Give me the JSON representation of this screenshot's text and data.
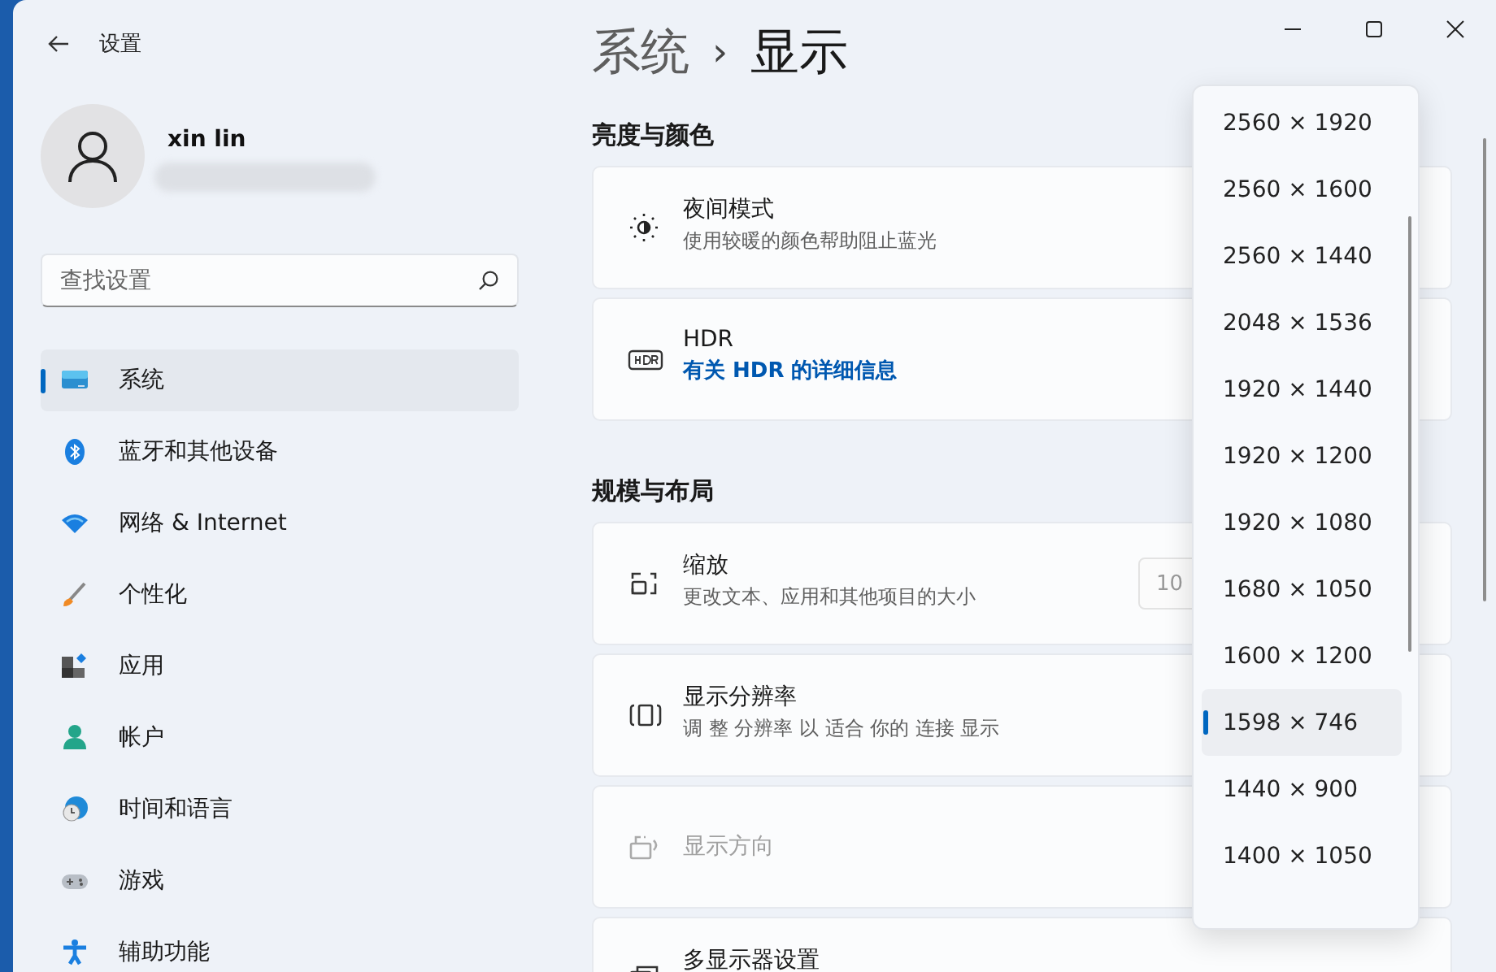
{
  "window": {
    "title": "设置"
  },
  "user": {
    "name": "xin lin"
  },
  "search": {
    "placeholder": "查找设置"
  },
  "sidebar": {
    "items": [
      {
        "label": "系统",
        "selected": true
      },
      {
        "label": "蓝牙和其他设备",
        "selected": false
      },
      {
        "label": "网络 & Internet",
        "selected": false
      },
      {
        "label": "个性化",
        "selected": false
      },
      {
        "label": "应用",
        "selected": false
      },
      {
        "label": "帐户",
        "selected": false
      },
      {
        "label": "时间和语言",
        "selected": false
      },
      {
        "label": "游戏",
        "selected": false
      },
      {
        "label": "辅助功能",
        "selected": false
      }
    ]
  },
  "breadcrumb": {
    "parent": "系统",
    "separator": "›",
    "current": "显示"
  },
  "sections": [
    {
      "title": "亮度与颜色",
      "cards": [
        {
          "title": "夜间模式",
          "subtitle": "使用较暖的颜色帮助阻止蓝光",
          "disabled": false
        },
        {
          "title": "HDR",
          "link": "有关 HDR 的详细信息",
          "disabled": false
        }
      ]
    },
    {
      "title": "规模与布局",
      "cards": [
        {
          "title": "缩放",
          "subtitle": "更改文本、应用和其他项目的大小",
          "value": "10",
          "disabled": false
        },
        {
          "title": "显示分辨率",
          "subtitle": "调 整 分辨率 以 适合 你的 连接 显示",
          "disabled": false
        },
        {
          "title": "显示方向",
          "disabled": true
        },
        {
          "title": "多显示器设置",
          "disabled": false
        }
      ]
    }
  ],
  "dropdown": {
    "options": [
      {
        "label": "2560 × 1920",
        "selected": false
      },
      {
        "label": "2560 × 1600",
        "selected": false
      },
      {
        "label": "2560 × 1440",
        "selected": false
      },
      {
        "label": "2048 × 1536",
        "selected": false
      },
      {
        "label": "1920 × 1440",
        "selected": false
      },
      {
        "label": "1920 × 1200",
        "selected": false
      },
      {
        "label": "1920 × 1080",
        "selected": false
      },
      {
        "label": "1680 × 1050",
        "selected": false
      },
      {
        "label": "1600 × 1200",
        "selected": false
      },
      {
        "label": "1598 × 746",
        "selected": true
      },
      {
        "label": "1440 × 900",
        "selected": false
      },
      {
        "label": "1400 × 1050",
        "selected": false
      }
    ]
  }
}
